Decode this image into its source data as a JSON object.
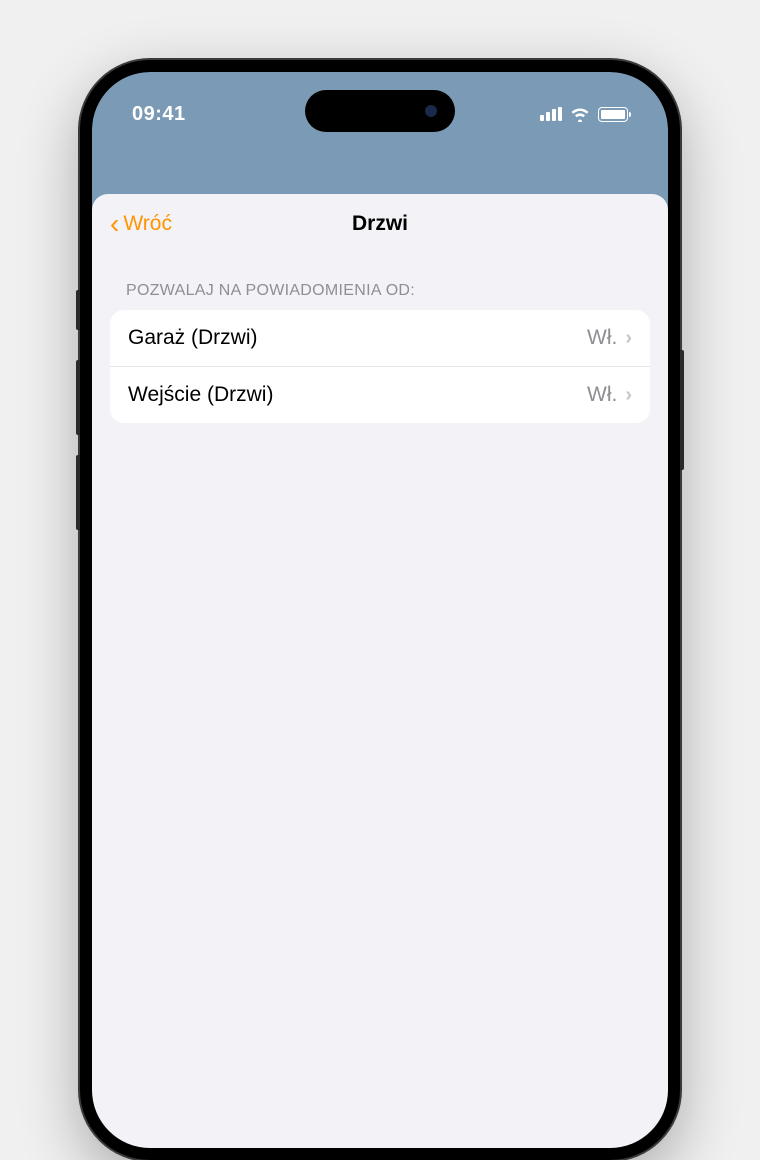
{
  "status": {
    "time": "09:41"
  },
  "nav": {
    "back_label": "Wróć",
    "title": "Drzwi"
  },
  "section": {
    "header": "POZWALAJ NA POWIADOMIENIA OD:"
  },
  "rows": [
    {
      "label": "Garaż (Drzwi)",
      "value": "Wł."
    },
    {
      "label": "Wejście (Drzwi)",
      "value": "Wł."
    }
  ]
}
